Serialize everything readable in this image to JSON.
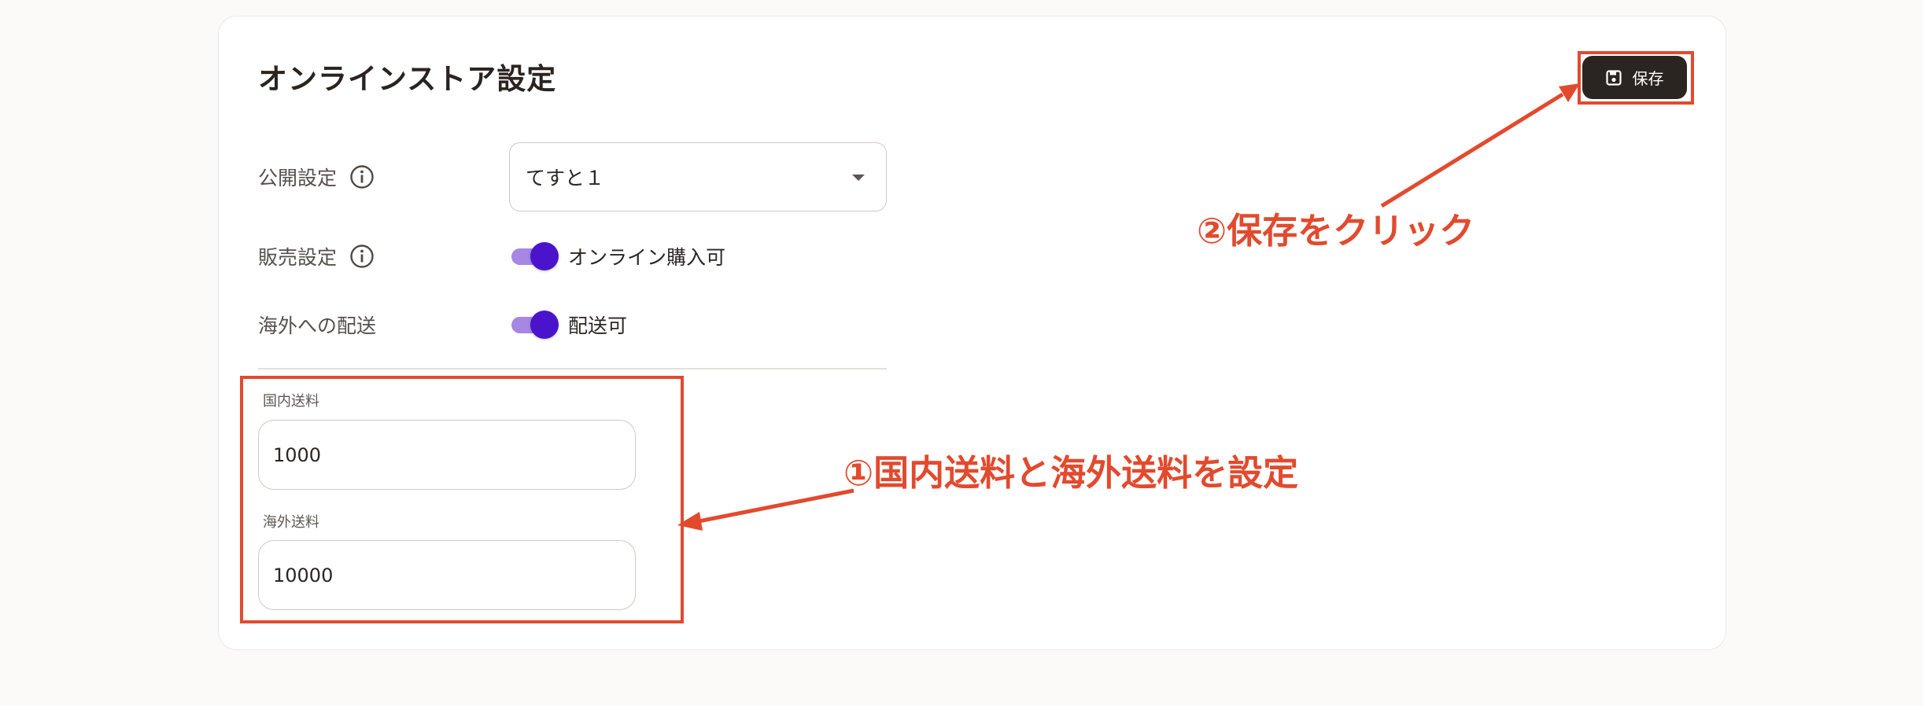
{
  "page": {
    "title": "オンラインストア設定"
  },
  "toolbar": {
    "save_label": "保存",
    "save_icon": "floppy-disk-icon"
  },
  "settings": {
    "visibility": {
      "label": "公開設定",
      "icon": "info-icon",
      "selected_value": "てすと１"
    },
    "sales": {
      "label": "販売設定",
      "icon": "info-icon",
      "toggle_on": true,
      "toggle_label": "オンライン購入可"
    },
    "overseas_shipping": {
      "label": "海外への配送",
      "toggle_on": true,
      "toggle_label": "配送可"
    }
  },
  "shipping": {
    "domestic": {
      "label": "国内送料",
      "value": "1000"
    },
    "overseas": {
      "label": "海外送料",
      "value": "10000"
    }
  },
  "annotations": {
    "step1": "①国内送料と海外送料を設定",
    "step2": "②保存をクリック",
    "color": "#e24a2e"
  },
  "colors": {
    "toggle_thumb": "#4a14cc",
    "toggle_track": "#a687e4",
    "save_button_bg": "#2b2522"
  }
}
